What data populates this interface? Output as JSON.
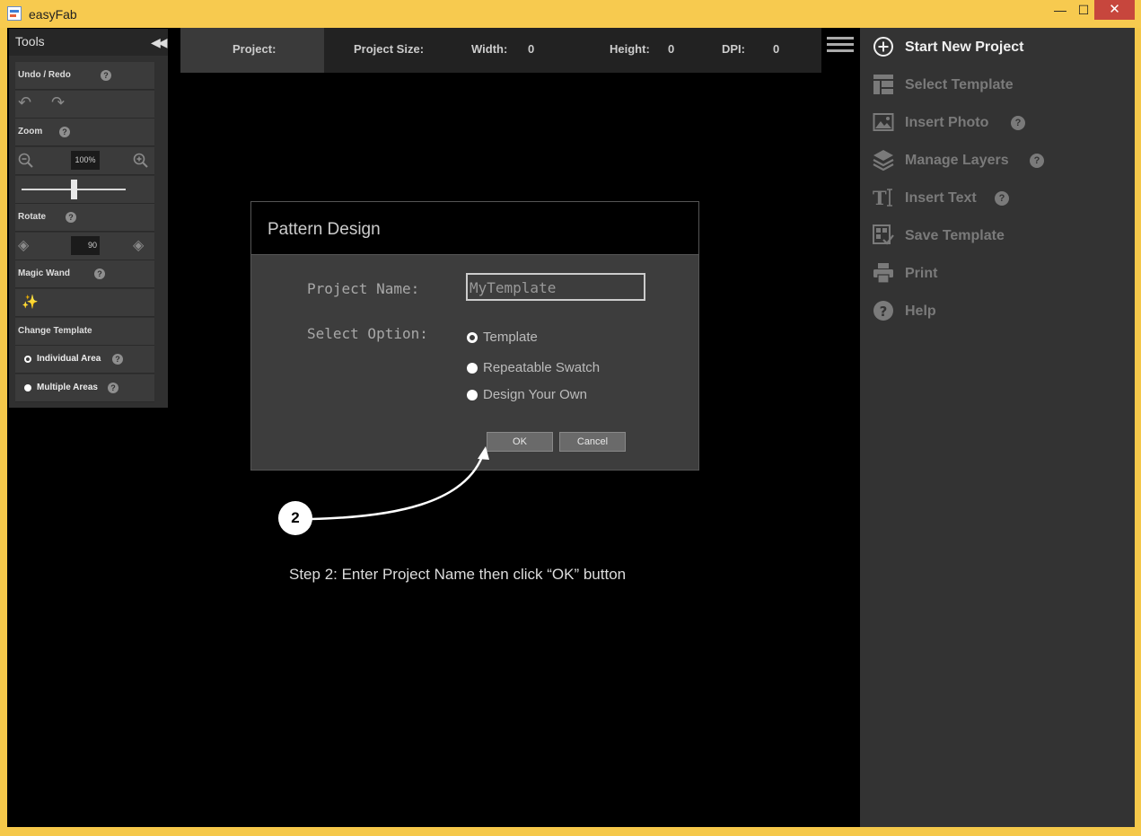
{
  "window": {
    "title": "easyFab",
    "minimize": "—",
    "maximize": "☐",
    "close": "✕"
  },
  "tools": {
    "title": "Tools",
    "undo_redo_label": "Undo / Redo",
    "zoom_label": "Zoom",
    "zoom_value": "100%",
    "zoom_slider_level": 0.5,
    "rotate_label": "Rotate",
    "rotate_value": "90",
    "magic_wand_label": "Magic Wand",
    "change_template_label": "Change Template",
    "individual_area_label": "Individual Area",
    "multiple_areas_label": "Multiple Areas",
    "help_glyph": "?"
  },
  "infobar": {
    "project_label": "Project:",
    "project_size_label": "Project Size:",
    "width_label": "Width:",
    "width_value": "0",
    "height_label": "Height:",
    "height_value": "0",
    "dpi_label": "DPI:",
    "dpi_value": "0"
  },
  "menu": {
    "start_new_project": "Start New Project",
    "select_template": "Select Template",
    "insert_photo": "Insert Photo",
    "manage_layers": "Manage Layers",
    "insert_text": "Insert Text",
    "save_template": "Save Template",
    "print": "Print",
    "help": "Help"
  },
  "dialog": {
    "title": "Pattern Design",
    "project_name_label": "Project Name:",
    "project_name_value": "MyTemplate",
    "select_option_label": "Select Option:",
    "options": [
      "Template",
      "Repeatable Swatch",
      "Design Your Own"
    ],
    "selected_option": "Template",
    "ok_label": "OK",
    "cancel_label": "Cancel"
  },
  "annotation": {
    "step_number": "2",
    "step_text": "Step 2:  Enter Project Name then click “OK” button"
  }
}
